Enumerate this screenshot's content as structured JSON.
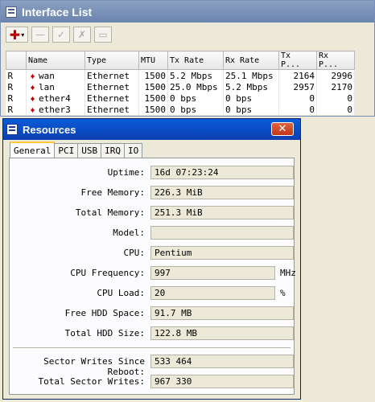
{
  "interface_window": {
    "title": "Interface List",
    "toolbar": {
      "add_symbol": "✚",
      "add_caret": "▾",
      "remove_symbol": "—",
      "enable_symbol": "✓",
      "disable_symbol": "✗",
      "comment_symbol": "▭"
    },
    "columns": [
      "",
      "Name",
      "Type",
      "MTU",
      "Tx Rate",
      "Rx Rate",
      "Tx P...",
      "Rx P..."
    ],
    "rows": [
      {
        "flag": "R",
        "name": "wan",
        "type": "Ethernet",
        "mtu": "1500",
        "tx_rate": "5.2 Mbps",
        "rx_rate": "25.1 Mbps",
        "tx_p": "2164",
        "rx_p": "2996"
      },
      {
        "flag": "R",
        "name": "lan",
        "type": "Ethernet",
        "mtu": "1500",
        "tx_rate": "25.0 Mbps",
        "rx_rate": "5.2 Mbps",
        "tx_p": "2957",
        "rx_p": "2170"
      },
      {
        "flag": "R",
        "name": "ether4",
        "type": "Ethernet",
        "mtu": "1500",
        "tx_rate": "0 bps",
        "rx_rate": "0 bps",
        "tx_p": "0",
        "rx_p": "0"
      },
      {
        "flag": "R",
        "name": "ether3",
        "type": "Ethernet",
        "mtu": "1500",
        "tx_rate": "0 bps",
        "rx_rate": "0 bps",
        "tx_p": "0",
        "rx_p": "0"
      }
    ]
  },
  "resources_window": {
    "title": "Resources",
    "close_symbol": "✕",
    "tabs": [
      "General",
      "PCI",
      "USB",
      "IRQ",
      "IO"
    ],
    "fields": {
      "uptime": {
        "label": "Uptime:",
        "value": "16d 07:23:24"
      },
      "free_memory": {
        "label": "Free Memory:",
        "value": "226.3 MiB"
      },
      "total_memory": {
        "label": "Total Memory:",
        "value": "251.3 MiB"
      },
      "model": {
        "label": "Model:",
        "value": ""
      },
      "cpu": {
        "label": "CPU:",
        "value": "Pentium"
      },
      "cpu_frequency": {
        "label": "CPU Frequency:",
        "value": "997",
        "unit": "MHz"
      },
      "cpu_load": {
        "label": "CPU Load:",
        "value": "20",
        "unit": "%"
      },
      "free_hdd": {
        "label": "Free HDD Space:",
        "value": "91.7 MB"
      },
      "total_hdd": {
        "label": "Total HDD Size:",
        "value": "122.8 MB"
      },
      "sector_writes_reboot": {
        "label": "Sector Writes Since Reboot:",
        "value": "533 464"
      },
      "total_sector_writes": {
        "label": "Total Sector Writes:",
        "value": "967 330"
      }
    }
  },
  "colors": {
    "xp_title_blue": "#0a5bd8",
    "inactive_title": "#7f96bd",
    "close_red": "#c2361a",
    "icon_red": "#c00000"
  }
}
